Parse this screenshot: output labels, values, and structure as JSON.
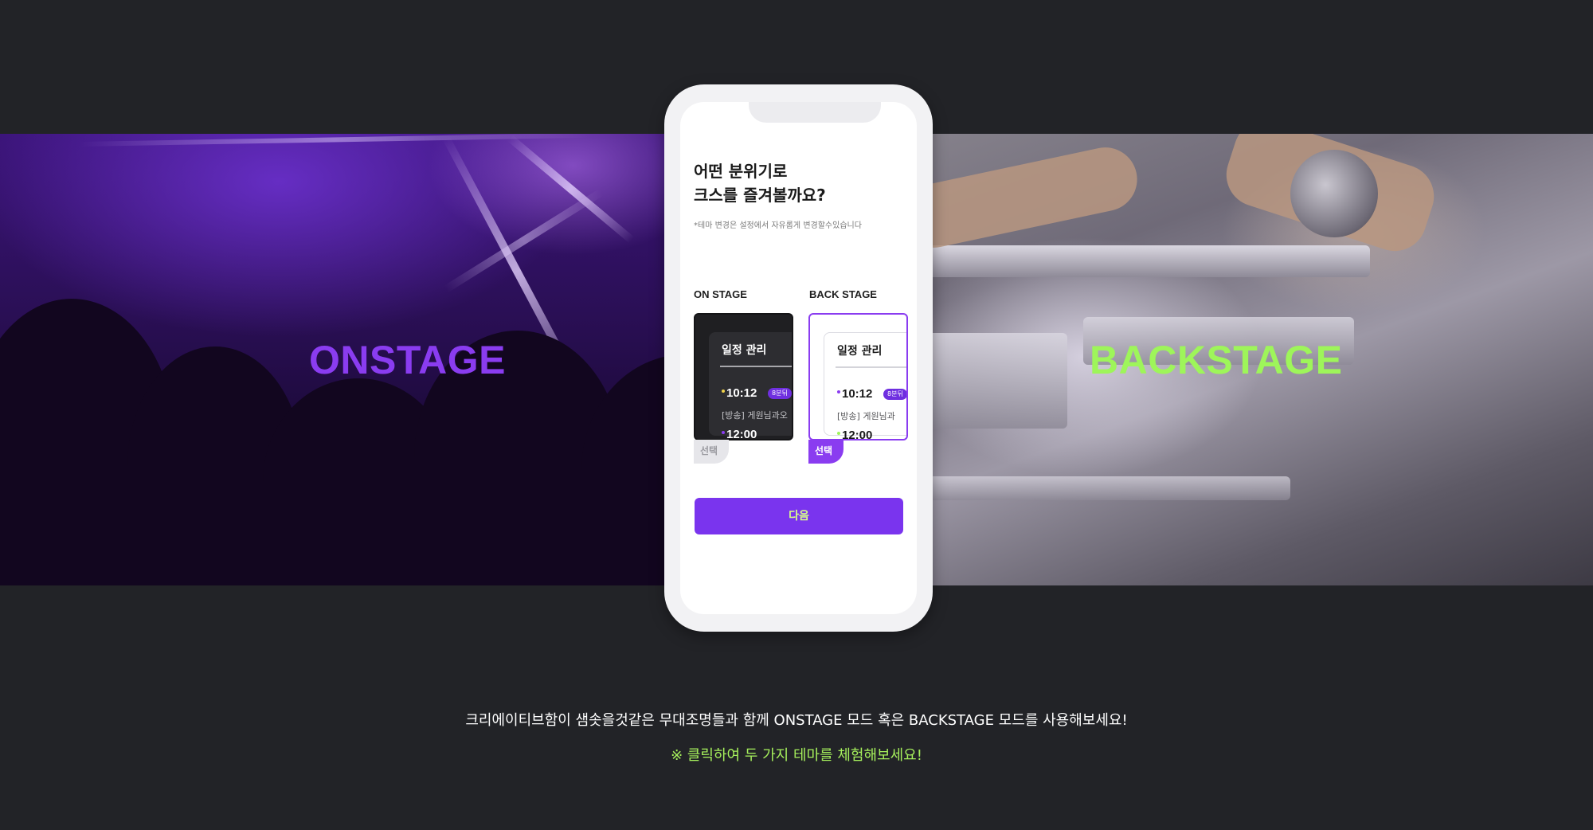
{
  "banner": {
    "onstage_title": "ONSTAGE",
    "backstage_title": "BACKSTAGE"
  },
  "phone": {
    "heading_line1": "어떤 분위기로",
    "heading_line2": "크스를 즐겨볼까요?",
    "subnote": "*테마 변경은 설정에서 자유롭게 변경할수있습니다",
    "option_on": {
      "label": "ON STAGE",
      "card_title": "일정 관리",
      "time1": "10:12",
      "badge": "8분뒤",
      "sub": "[방송] 게원님과오",
      "time2": "12:00",
      "select_label": "선택"
    },
    "option_back": {
      "label": "BACK STAGE",
      "card_title": "일정 관리",
      "time1": "10:12",
      "badge": "8분뒤",
      "sub": "[방송] 게원님과",
      "time2": "12:00",
      "select_label": "선택"
    },
    "next_button": "다음"
  },
  "captions": {
    "line1": "크리에이티브함이 샘솟을것같은 무대조명들과 함께 ONSTAGE 모드 혹은 BACKSTAGE 모드를 사용해보세요!",
    "line2": "※ 클릭하여 두 가지 테마를 체험해보세요!"
  },
  "colors": {
    "background": "#222327",
    "onstage_accent": "#8a3cf0",
    "backstage_accent": "#9ef55a",
    "button": "#7a34ee"
  }
}
